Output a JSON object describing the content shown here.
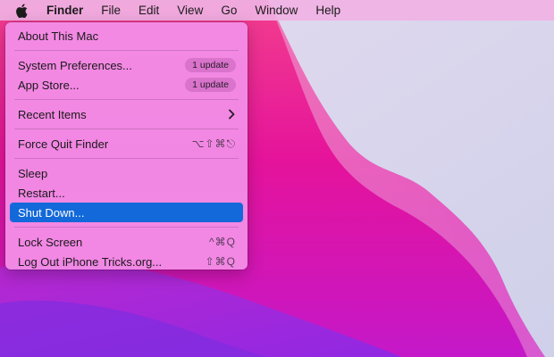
{
  "menubar": {
    "items": [
      {
        "label": "Finder"
      },
      {
        "label": "File"
      },
      {
        "label": "Edit"
      },
      {
        "label": "View"
      },
      {
        "label": "Go"
      },
      {
        "label": "Window"
      },
      {
        "label": "Help"
      }
    ]
  },
  "apple_menu": {
    "about": "About This Mac",
    "system_prefs": {
      "label": "System Preferences...",
      "badge": "1 update"
    },
    "app_store": {
      "label": "App Store...",
      "badge": "1 update"
    },
    "recent_items": "Recent Items",
    "force_quit": {
      "label": "Force Quit Finder",
      "shortcut": "⌥⇧⌘⎋"
    },
    "sleep": "Sleep",
    "restart": "Restart...",
    "shut_down": "Shut Down...",
    "lock_screen": {
      "label": "Lock Screen",
      "shortcut": "^⌘Q"
    },
    "log_out": {
      "label": "Log Out iPhone Tricks.org...",
      "shortcut": "⇧⌘Q"
    }
  },
  "colors": {
    "menubar_bg": "#f0b2e4",
    "menu_bg": "#f28ce6",
    "selection": "#1369d9",
    "wallpaper_magenta": "#e0158f",
    "wallpaper_lavender": "#d5d3ec"
  },
  "icons": {
    "apple": "apple-logo-icon",
    "submenu": "chevron-right-icon"
  }
}
